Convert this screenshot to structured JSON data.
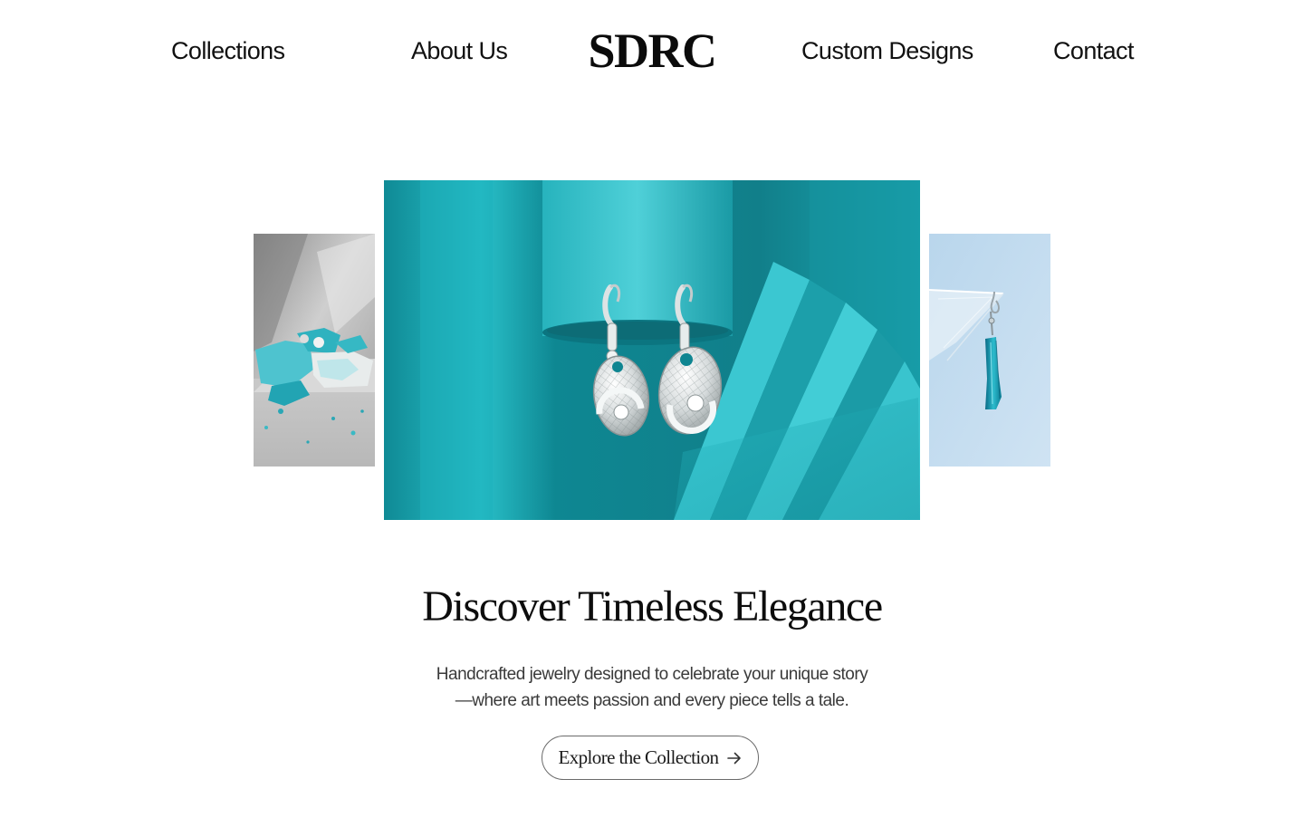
{
  "brand": {
    "logo_text": "SDRC"
  },
  "nav": {
    "items": [
      {
        "label": "Collections"
      },
      {
        "label": "About Us"
      },
      {
        "label": "Custom Designs"
      },
      {
        "label": "Contact"
      }
    ]
  },
  "gallery": {
    "images": [
      {
        "icon": "turquoise-stones-photo",
        "alt": ""
      },
      {
        "icon": "silver-earrings-photo",
        "alt": ""
      },
      {
        "icon": "blue-drop-earring-photo",
        "alt": ""
      }
    ]
  },
  "hero": {
    "title": "Discover Timeless Elegance",
    "subtitle_line1": "Handcrafted jewelry designed to celebrate your unique story",
    "subtitle_line2": "—where art meets passion and every piece tells a tale.",
    "cta_label": "Explore the Collection",
    "cta_icon": "arrow-right-icon"
  },
  "colors": {
    "accent_teal": "#1aa3ad",
    "text_primary": "#111111",
    "text_secondary": "#3a3a3a",
    "button_border": "#6b6b6b",
    "background": "#ffffff"
  }
}
